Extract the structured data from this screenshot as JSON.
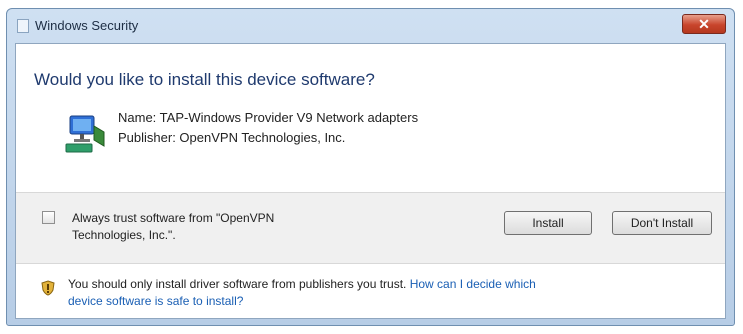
{
  "window": {
    "title": "Windows Security",
    "close_label": "✕"
  },
  "main": {
    "question": "Would you like to install this device software?",
    "device_name": "Name: TAP-Windows Provider V9 Network adapters",
    "device_publisher": "Publisher: OpenVPN Technologies, Inc."
  },
  "options": {
    "always_trust_line1": "Always trust software from \"OpenVPN",
    "always_trust_line2": "Technologies, Inc.\".",
    "install_label": "Install",
    "dont_install_label": "Don't Install"
  },
  "footer": {
    "text": "You should only install driver software from publishers you trust. ",
    "link1": "How can I decide which",
    "link2": "device software is safe to install?"
  },
  "colors": {
    "accent": "#1f3a6e",
    "link": "#1a5fb4",
    "close_red": "#c8452c"
  },
  "icons": [
    "window-icon",
    "network-adapter-icon",
    "shield-icon",
    "close-icon"
  ]
}
